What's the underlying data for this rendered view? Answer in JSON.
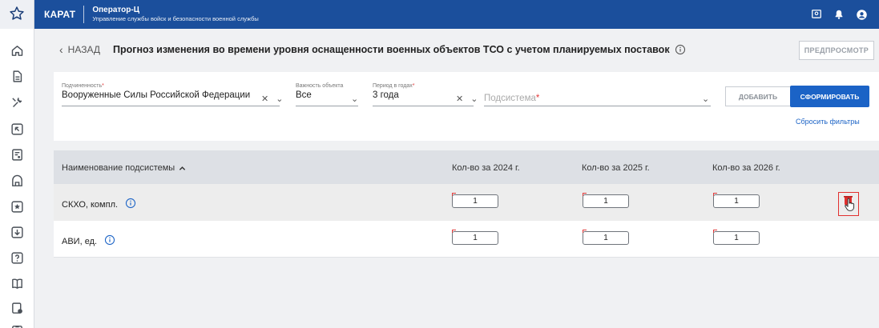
{
  "app": {
    "brand": "КАРАТ",
    "title": "Оператор-Ц",
    "subtitle": "Управление службы войск и безопасности военной службы"
  },
  "header": {
    "back_label": "НАЗАД",
    "page_title": "Прогноз изменения во времени уровня оснащенности военных объектов ТСО с учетом планируемых поставок",
    "preview_label": "ПРЕДПРОСМОТР"
  },
  "filters": {
    "subordination": {
      "label": "Подчиненность",
      "value": "Вооруженные Силы Российской Федерации"
    },
    "importance": {
      "label": "Важность объекта",
      "value": "Все"
    },
    "period": {
      "label": "Период в годах",
      "value": "3 года"
    },
    "subsystem": {
      "placeholder": "Подсистема"
    },
    "add_label": "ДОБАВИТЬ",
    "form_label": "СФОРМИРОВАТЬ",
    "reset_label": "Сбросить фильтры",
    "required_mark": "*"
  },
  "table": {
    "columns": [
      "Наименование подсистемы",
      "Кол-во за 2024 г.",
      "Кол-во за 2025 г.",
      "Кол-во за 2026 г."
    ],
    "rows": [
      {
        "name": "СКХО, компл.",
        "values": [
          "1",
          "1",
          "1"
        ]
      },
      {
        "name": "АВИ, ед.",
        "values": [
          "1",
          "1",
          "1"
        ]
      }
    ]
  },
  "colors": {
    "topbar": "#1b4f9c",
    "primary_button": "#1b63c6",
    "delete_highlight": "#e2302f",
    "required": "#e23b3b"
  },
  "icons": {
    "favorites": "star-icon",
    "nav": [
      "home-icon",
      "document-icon",
      "tools-icon",
      "arrow-box-icon",
      "user-doc-icon",
      "archive-icon",
      "star-box-icon",
      "download-box-icon",
      "help-box-icon",
      "book-icon",
      "settings-doc-icon",
      "clipboard-icon"
    ],
    "top": [
      "screen-icon",
      "bell-icon",
      "user-circle-icon"
    ],
    "row_action": "delete-icon"
  }
}
